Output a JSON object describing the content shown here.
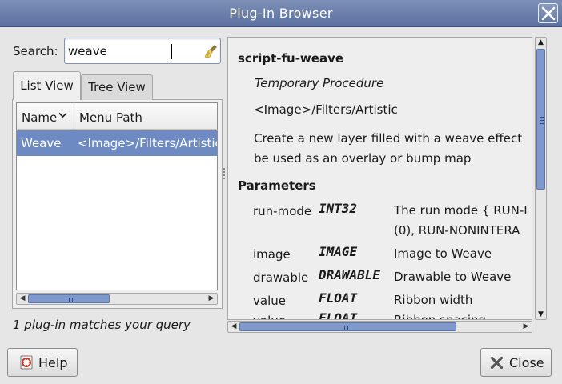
{
  "window": {
    "title": "Plug-In Browser"
  },
  "search": {
    "label": "Search:",
    "value": "weave"
  },
  "tabs": [
    {
      "label": "List View",
      "active": true
    },
    {
      "label": "Tree View",
      "active": false
    }
  ],
  "list": {
    "columns": [
      "Name",
      "Menu Path"
    ],
    "rows": [
      {
        "name": "Weave",
        "menu_path": "<Image>/Filters/Artistic",
        "selected": true
      }
    ]
  },
  "match_text": "1 plug-in matches your query",
  "details": {
    "name": "script-fu-weave",
    "type": "Temporary Procedure",
    "menu": "<Image>/Filters/Artistic",
    "description_lines": [
      "Create a new layer filled with a weave effect",
      "be used as an overlay or bump map"
    ],
    "parameters_heading": "Parameters",
    "parameters": [
      {
        "name": "run-mode",
        "type": "INT32",
        "desc_lines": [
          "The run mode { RUN-I",
          "(0), RUN-NONINTERA"
        ]
      },
      {
        "name": "image",
        "type": "IMAGE",
        "desc_lines": [
          "Image to Weave"
        ]
      },
      {
        "name": "drawable",
        "type": "DRAWABLE",
        "desc_lines": [
          "Drawable to Weave"
        ]
      },
      {
        "name": "value",
        "type": "FLOAT",
        "desc_lines": [
          "Ribbon width"
        ]
      },
      {
        "name": "value",
        "type": "FLOAT",
        "desc_lines": [
          "Ribbon spacing"
        ]
      }
    ]
  },
  "buttons": {
    "help": "Help",
    "close": "Close"
  },
  "colors": {
    "titlebar": "#6a7eab",
    "selection": "#6d8ac2",
    "scroll_thumb": "#7f99cc"
  }
}
